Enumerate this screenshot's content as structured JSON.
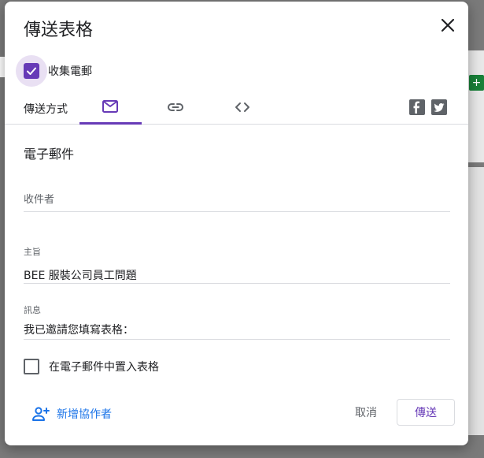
{
  "dialog": {
    "title": "傳送表格",
    "close_icon": "close-icon"
  },
  "collect_email": {
    "label": "收集電郵",
    "checked": true
  },
  "send_via": {
    "label": "傳送方式",
    "tabs": [
      {
        "name": "email",
        "icon": "email-icon",
        "selected": true
      },
      {
        "name": "link",
        "icon": "link-icon",
        "selected": false
      },
      {
        "name": "embed",
        "icon": "code-icon",
        "selected": false
      }
    ],
    "social": [
      "facebook-icon",
      "twitter-icon"
    ]
  },
  "email_form": {
    "section_title": "電子郵件",
    "recipients_placeholder": "收件者",
    "recipients_value": "",
    "subject_label": "主旨",
    "subject_value": "BEE 服裝公司員工問題",
    "message_label": "訊息",
    "message_value": "我已邀請您填寫表格：",
    "embed_label": "在電子郵件中置入表格",
    "embed_checked": false
  },
  "footer": {
    "add_collaborators": "新增協作者",
    "cancel": "取消",
    "send": "傳送"
  },
  "colors": {
    "accent": "#673ab7",
    "link": "#1a73e8"
  }
}
